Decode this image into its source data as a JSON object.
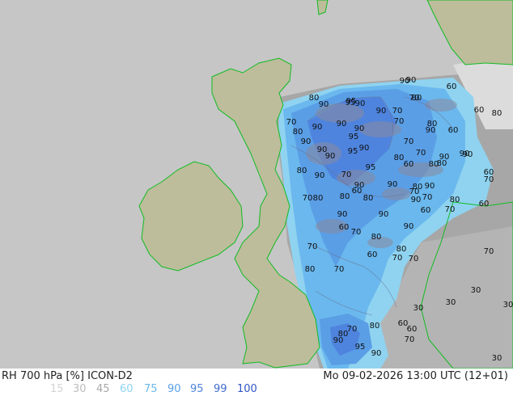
{
  "header": {
    "title_left": "RH 700 hPa [%] ICON-D2",
    "title_right": "Mo 09-02-2026 13:00 UTC (12+01)"
  },
  "legend": {
    "items": [
      {
        "label": "15",
        "color": "#d4d4d4"
      },
      {
        "label": "30",
        "color": "#bcbcbc"
      },
      {
        "label": "45",
        "color": "#a8a8a8"
      },
      {
        "label": "60",
        "color": "#8fd3f0"
      },
      {
        "label": "75",
        "color": "#6ab8ee"
      },
      {
        "label": "90",
        "color": "#5a9ee6"
      },
      {
        "label": "95",
        "color": "#4e84de"
      },
      {
        "label": "99",
        "color": "#3f6bd2"
      },
      {
        "label": "100",
        "color": "#2f55c4"
      }
    ]
  },
  "map": {
    "contour_labels": [
      "80",
      "90",
      "95",
      "90",
      "70",
      "90",
      "80",
      "90",
      "90",
      "95",
      "95",
      "90",
      "90",
      "90",
      "95",
      "95",
      "90",
      "90",
      "80",
      "70",
      "90",
      "60",
      "80",
      "90",
      "80",
      "70",
      "90",
      "90",
      "80",
      "60",
      "70",
      "80",
      "90",
      "70",
      "60",
      "80",
      "70",
      "80",
      "90",
      "80",
      "70",
      "90",
      "70",
      "80",
      "60",
      "70",
      "60",
      "70",
      "90",
      "60",
      "80",
      "90",
      "70",
      "70",
      "60",
      "90",
      "80",
      "70",
      "60",
      "80",
      "70",
      "90",
      "80",
      "90",
      "70",
      "90",
      "60",
      "80",
      "90",
      "60",
      "70",
      "80",
      "70",
      "80",
      "60",
      "70",
      "30",
      "30",
      "30",
      "60",
      "70",
      "80",
      "90",
      "95",
      "90",
      "70",
      "30",
      "30"
    ]
  },
  "colors": {
    "sea": "#c6c6c6",
    "land": "#bdbd9c",
    "coast": "#11bb22",
    "rh60": "#8fd3f0",
    "rh75": "#6ab8ee",
    "rh90": "#5a9ee6",
    "rh95": "#4e84de"
  }
}
